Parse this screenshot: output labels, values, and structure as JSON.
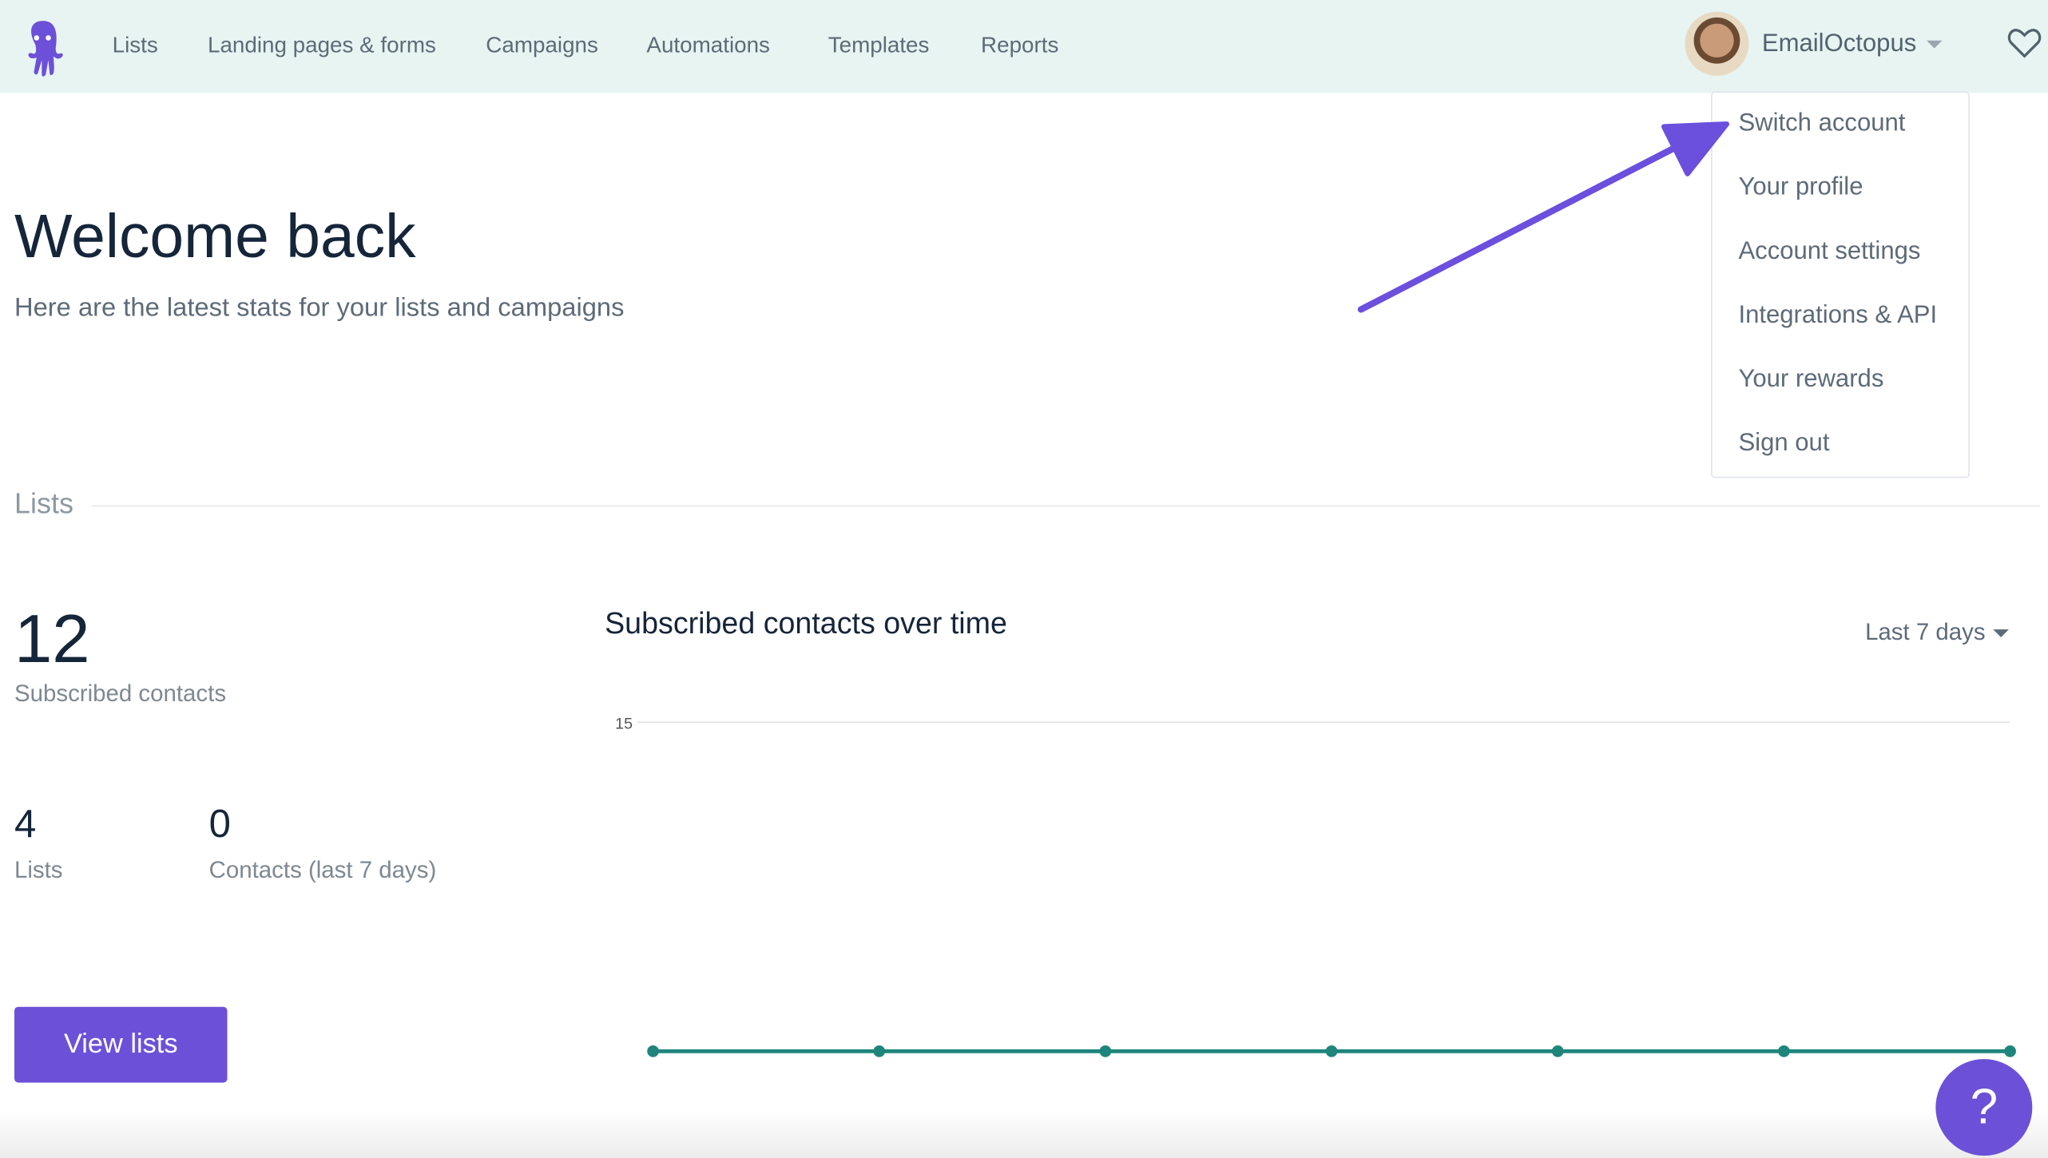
{
  "nav": {
    "items": [
      "Lists",
      "Landing pages & forms",
      "Campaigns",
      "Automations",
      "Templates",
      "Reports"
    ],
    "brand_color": "#6d50d8"
  },
  "account": {
    "name": "EmailOctopus",
    "menu": [
      "Switch account",
      "Your profile",
      "Account settings",
      "Integrations & API",
      "Your rewards",
      "Sign out"
    ]
  },
  "main": {
    "title": "Welcome back",
    "subtitle": "Here are the latest stats for your lists and campaigns",
    "section": "Lists",
    "subscribed": {
      "value": "12",
      "label": "Subscribed contacts"
    },
    "lists": {
      "value": "4",
      "label": "Lists"
    },
    "recent": {
      "value": "0",
      "label": "Contacts (last 7 days)"
    },
    "view_lists": "View lists"
  },
  "chart_data": {
    "type": "line",
    "title": "Subscribed contacts over time",
    "range_select": "Last 7 days",
    "y_ticks": [
      "15"
    ],
    "ylim": [
      0,
      15
    ],
    "values": [
      0,
      0,
      0,
      0,
      0,
      0,
      0
    ],
    "color": "#1f857c",
    "grid": true
  },
  "help": "?",
  "annotation": {
    "arrow_color": "#6b4fdd"
  }
}
